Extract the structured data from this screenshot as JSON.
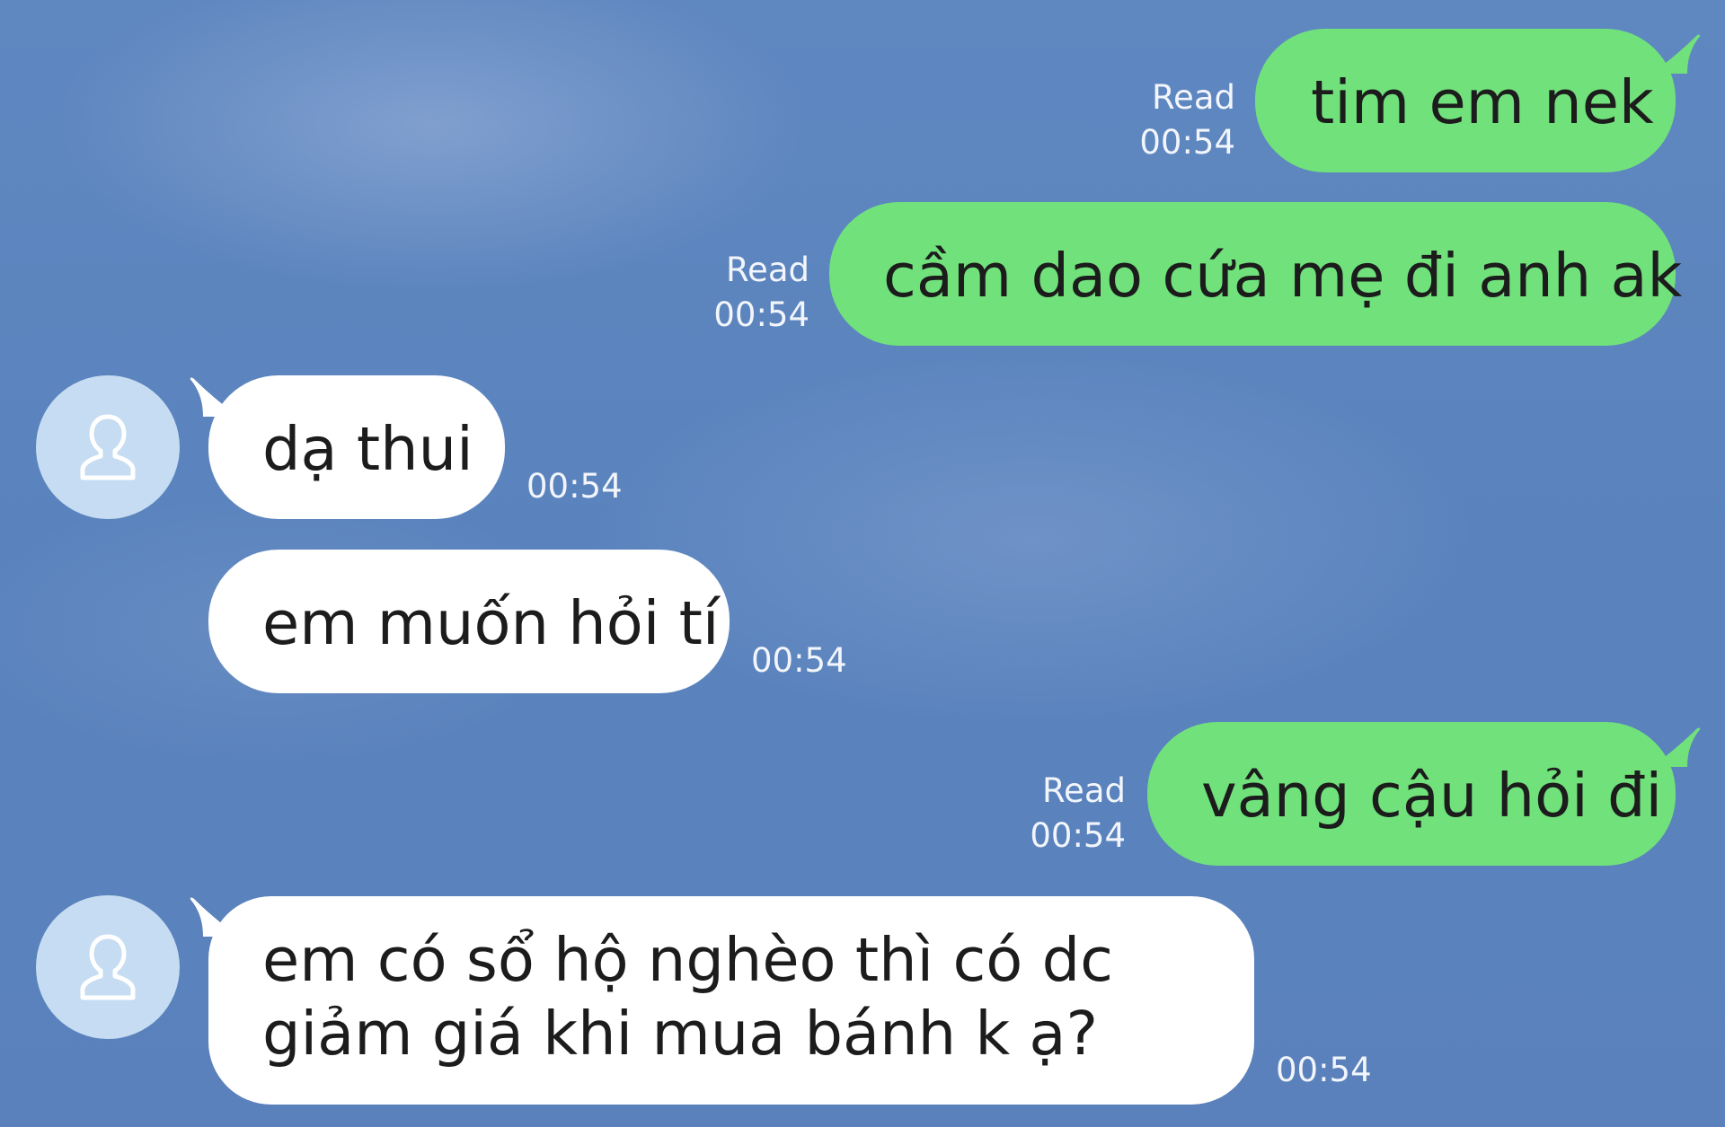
{
  "messages": [
    {
      "direction": "out",
      "text": "tim em nek",
      "read_label": "Read",
      "time": "00:54"
    },
    {
      "direction": "out",
      "text": "cầm dao cứa mẹ đi anh ak",
      "read_label": "Read",
      "time": "00:54"
    },
    {
      "direction": "in",
      "text": "dạ thui",
      "time": "00:54"
    },
    {
      "direction": "in",
      "text": "em muốn hỏi tí",
      "time": "00:54"
    },
    {
      "direction": "out",
      "text": "vâng cậu hỏi đi",
      "read_label": "Read",
      "time": "00:54"
    },
    {
      "direction": "in",
      "lines": [
        "em có sổ hộ nghèo thì có dc",
        "giảm giá khi mua bánh k ạ?"
      ],
      "time": "00:54"
    }
  ],
  "colors": {
    "background": "#5a83bd",
    "outgoing_bubble": "#71e17c",
    "incoming_bubble": "#ffffff",
    "avatar": "#c5dcf2",
    "meta_text": "#f2f5fb"
  },
  "icons": {
    "avatar": "person-outline-icon"
  }
}
